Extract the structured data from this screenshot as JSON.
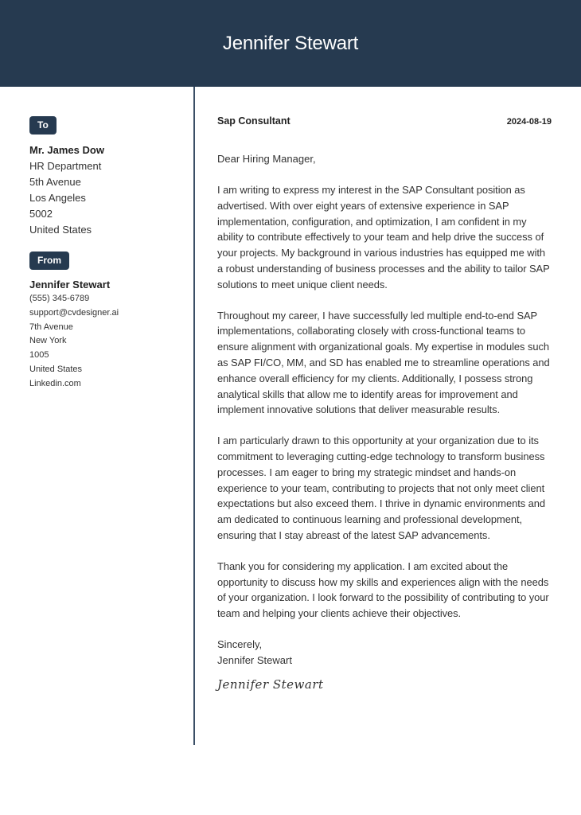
{
  "header": {
    "name": "Jennifer Stewart"
  },
  "colors": {
    "accent": "#263a50",
    "text": "#333333"
  },
  "recipient": {
    "badge": "To",
    "name": "Mr. James Dow",
    "lines": [
      "HR Department",
      "5th Avenue",
      "Los Angeles",
      "5002",
      "United States"
    ]
  },
  "sender": {
    "badge": "From",
    "name": "Jennifer Stewart",
    "lines": [
      "(555) 345-6789",
      "support@cvdesigner.ai",
      "7th Avenue",
      "New York",
      "1005",
      "United States",
      "Linkedin.com"
    ]
  },
  "letter": {
    "job_title": "Sap Consultant",
    "date": "2024-08-19",
    "salutation": "Dear Hiring Manager,",
    "paragraphs": [
      "I am writing to express my interest in the SAP Consultant position as advertised. With over eight years of extensive experience in SAP implementation, configuration, and optimization, I am confident in my ability to contribute effectively to your team and help drive the success of your projects. My background in various industries has equipped me with a robust understanding of business processes and the ability to tailor SAP solutions to meet unique client needs.",
      "Throughout my career, I have successfully led multiple end-to-end SAP implementations, collaborating closely with cross-functional teams to ensure alignment with organizational goals. My expertise in modules such as SAP FI/CO, MM, and SD has enabled me to streamline operations and enhance overall efficiency for my clients. Additionally, I possess strong analytical skills that allow me to identify areas for improvement and implement innovative solutions that deliver measurable results.",
      "I am particularly drawn to this opportunity at your organization due to its commitment to leveraging cutting-edge technology to transform business processes. I am eager to bring my strategic mindset and hands-on experience to your team, contributing to projects that not only meet client expectations but also exceed them. I thrive in dynamic environments and am dedicated to continuous learning and professional development, ensuring that I stay abreast of the latest SAP advancements.",
      "Thank you for considering my application. I am excited about the opportunity to discuss how my skills and experiences align with the needs of your organization. I look forward to the possibility of contributing to your team and helping your clients achieve their objectives."
    ],
    "closing": "Sincerely,",
    "closing_name": "Jennifer Stewart",
    "signature": "Jennifer Stewart"
  }
}
